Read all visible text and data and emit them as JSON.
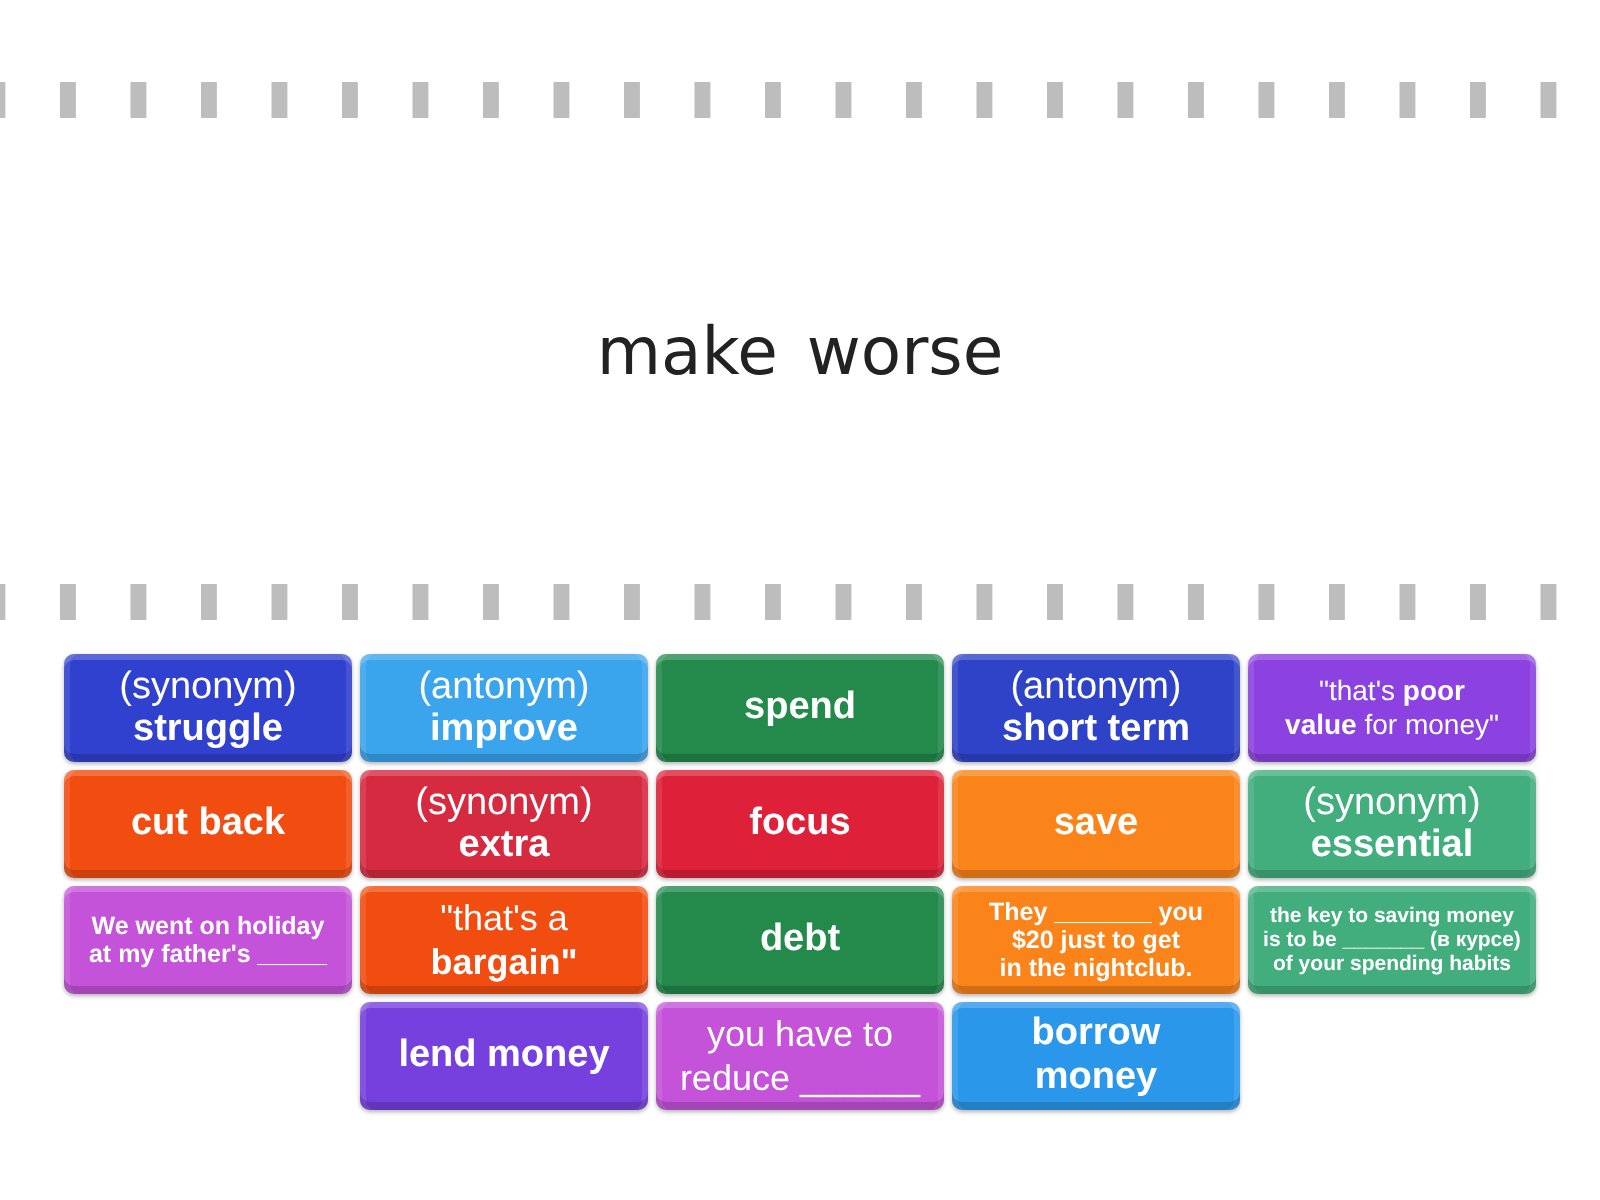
{
  "prompt": {
    "text": "make worse"
  },
  "tiles": [
    {
      "kind": "pair",
      "label": "(synonym)",
      "term": "struggle",
      "color": "#3141cf"
    },
    {
      "kind": "pair",
      "label": "(antonym)",
      "term": "improve",
      "color": "#3aa4ec"
    },
    {
      "kind": "term",
      "text": "spend",
      "color": "#238a4b"
    },
    {
      "kind": "pair",
      "label": "(antonym)",
      "term": "short term",
      "color": "#2f43c9"
    },
    {
      "kind": "phrase",
      "text": "\"that's **poor value** for money\"",
      "color": "#8c42e0"
    },
    {
      "kind": "term",
      "text": "cut back",
      "color": "#f24d10"
    },
    {
      "kind": "pair",
      "label": "(synonym)",
      "term": "extra",
      "color": "#d62a40"
    },
    {
      "kind": "term",
      "text": "focus",
      "color": "#de2139"
    },
    {
      "kind": "term",
      "text": "save",
      "color": "#fa841a"
    },
    {
      "kind": "pair",
      "label": "(synonym)",
      "term": "essential",
      "color": "#42ae7e"
    },
    {
      "kind": "sentence",
      "text": "We went on holiday at my father's _____",
      "color": "#c453d9"
    },
    {
      "kind": "phrase",
      "text": "\"that's a **bargain\"**",
      "color": "#f24d10"
    },
    {
      "kind": "term",
      "text": "debt",
      "color": "#238a4b"
    },
    {
      "kind": "sentence",
      "text": "They _______ you $20 just to get in the nightclub.",
      "color": "#fa841a"
    },
    {
      "kind": "sentence",
      "text": "the key to saving money is to be _______ (в курсе) of your spending habits",
      "color": "#42ae7e"
    },
    {
      "kind": "term",
      "text": "lend money",
      "color": "#7640de"
    },
    {
      "kind": "phrase",
      "text": "you have to reduce ______",
      "color": "#c453d9"
    },
    {
      "kind": "term",
      "text": "borrow money",
      "color": "#2b97ea"
    }
  ]
}
